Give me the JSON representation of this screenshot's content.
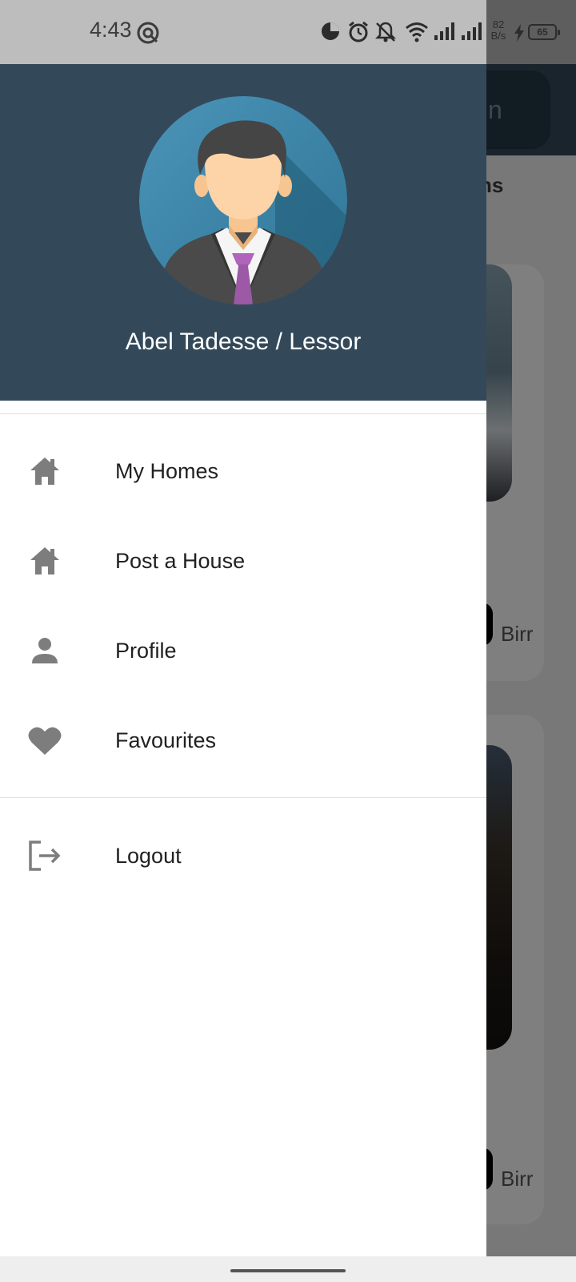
{
  "status_bar": {
    "time": "4:43",
    "net_speed_value": "82",
    "net_speed_unit": "B/s",
    "battery_level": "65"
  },
  "drawer": {
    "user_name": "Abel Tadesse / Lessor",
    "menu": [
      {
        "label": "My Homes",
        "icon": "house-icon"
      },
      {
        "label": "Post a House",
        "icon": "house-icon"
      },
      {
        "label": "Profile",
        "icon": "person-icon"
      },
      {
        "label": "Favourites",
        "icon": "heart-icon"
      }
    ],
    "logout": {
      "label": "Logout",
      "icon": "logout-icon"
    }
  },
  "background": {
    "appbar_button_fragment": "n",
    "section_title_fragment": "ooms",
    "currency_1": "Birr",
    "currency_2": "Birr"
  },
  "colors": {
    "header": "#33495a",
    "menu_icon": "#7d7d7d",
    "tie": "#9b59a6",
    "avatar_bg": "#3f8db0"
  }
}
